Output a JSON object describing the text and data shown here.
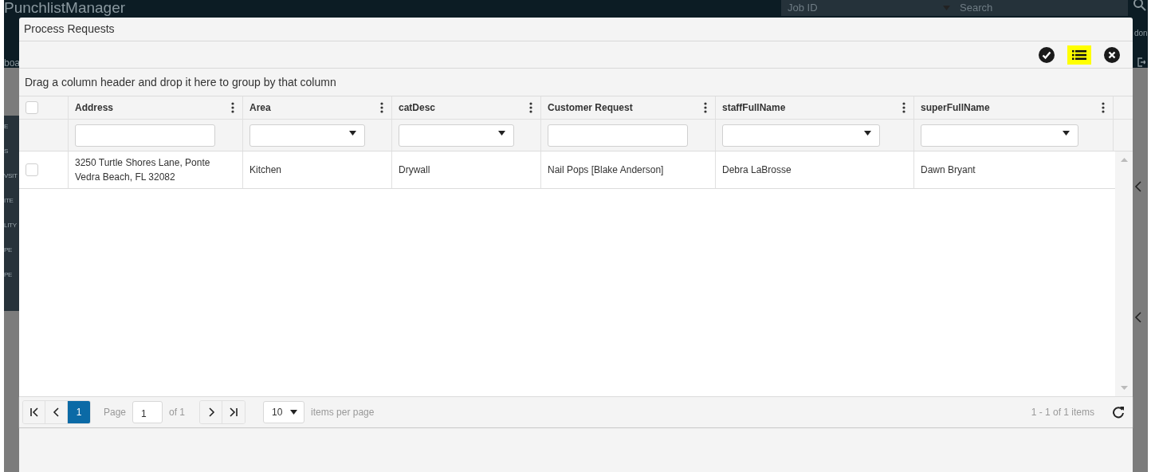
{
  "background_app": {
    "logo": "PunchlistManager",
    "job_id_placeholder": "Job ID",
    "search_placeholder": "Search",
    "left_fragment": "boa",
    "right_fragment": "don",
    "sidebar_fragments": [
      "E",
      "S",
      "VSIT",
      "ITE",
      "LITY",
      "PE",
      "PE"
    ]
  },
  "dialog": {
    "title": "Process Requests",
    "toolbar": [
      {
        "kind": "check",
        "highlighted": false
      },
      {
        "kind": "list",
        "highlighted": true
      },
      {
        "kind": "close",
        "highlighted": false
      }
    ],
    "group_panel": "Drag a column header and drop it here to group by that column",
    "table": {
      "header_checkbox": {
        "checked": false
      },
      "columns": [
        {
          "label": "Address",
          "filter": {
            "kind": "text"
          }
        },
        {
          "label": "Area",
          "filter": {
            "kind": "dropdown"
          }
        },
        {
          "label": "catDesc",
          "filter": {
            "kind": "dropdown"
          }
        },
        {
          "label": "Customer Request",
          "filter": {
            "kind": "text"
          }
        },
        {
          "label": "staffFullName",
          "filter": {
            "kind": "dropdown"
          }
        },
        {
          "label": "superFullName",
          "filter": {
            "kind": "dropdown"
          }
        }
      ],
      "rows": [
        {
          "checked": false,
          "cells": [
            "3250 Turtle Shores Lane, Ponte Vedra Beach, FL 32082",
            "Kitchen",
            "Drywall",
            "Nail Pops [Blake Anderson]",
            "Debra LaBrosse",
            "Dawn Bryant"
          ]
        }
      ]
    },
    "pager": {
      "pages": [
        {
          "label": "1",
          "selected": true
        }
      ],
      "page_label": "Page",
      "page_value": "1",
      "of_label": "of 1",
      "page_size": "10",
      "page_size_label": "items per page",
      "summary": "1 - 1 of 1 items"
    }
  }
}
